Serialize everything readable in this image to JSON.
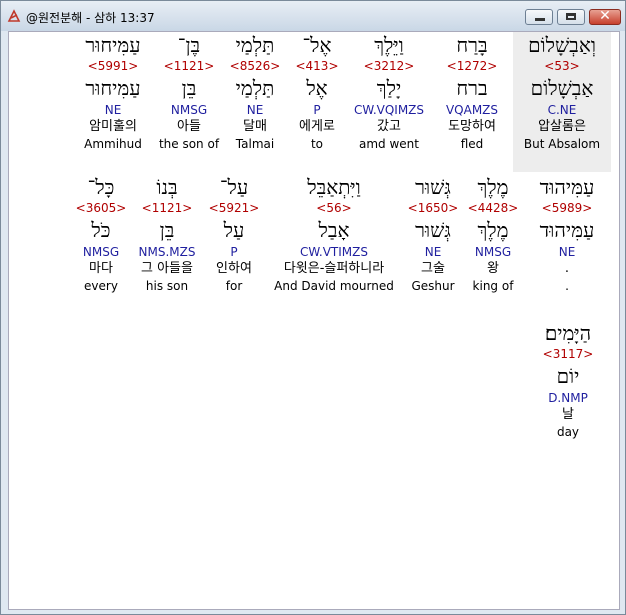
{
  "window": {
    "title": "@원전분해 - 삼하 13:37",
    "icons": {
      "app": "app-logo-icon",
      "minimize": "minimize-icon",
      "maximize": "maximize-icon",
      "close": "close-icon"
    }
  },
  "rows": [
    [
      {
        "heb": "וְאַבְשָׁלוֹם",
        "num": "<53>",
        "lemma": "אַבְשָׁלוֹם",
        "parse": "C.NE",
        "kor": "압살롬은",
        "eng": "But Absalom",
        "selected": true
      },
      {
        "heb": "בָּרַח",
        "num": "<1272>",
        "lemma": "ברח",
        "parse": "VQAMZS",
        "kor": "도망하여",
        "eng": "fled"
      },
      {
        "heb": "וַיֵּלֶךְ",
        "num": "<3212>",
        "lemma": "יָלַךְ",
        "parse": "CW.VQIMZS",
        "kor": "갔고",
        "eng": "amd went"
      },
      {
        "heb": "אֶל־",
        "num": "<413>",
        "lemma": "אֶל",
        "parse": "P",
        "kor": "에게로",
        "eng": "to"
      },
      {
        "heb": "תַּלְמַי",
        "num": "<8526>",
        "lemma": "תַּלְמַי",
        "parse": "NE",
        "kor": "달매",
        "eng": "Talmai"
      },
      {
        "heb": "בֶּן־",
        "num": "<1121>",
        "lemma": "בֵּן",
        "parse": "NMSG",
        "kor": "아들",
        "eng": "the son of"
      },
      {
        "heb": "עַמִּיחוּר",
        "num": "<5991>",
        "lemma": "עַמִּיחוּר",
        "parse": "NE",
        "kor": "암미훌의",
        "eng": "Ammihud"
      }
    ],
    [
      {
        "heb": "עַמִּיהוּד",
        "num": "<5989>",
        "lemma": "עַמִּיהוּד",
        "parse": "NE",
        "kor": ".",
        "eng": "."
      },
      {
        "heb": "מֶלֶךְ",
        "num": "<4428>",
        "lemma": "מֶלֶךְ",
        "parse": "NMSG",
        "kor": "왕",
        "eng": "king of"
      },
      {
        "heb": "גְּשׁוּר",
        "num": "<1650>",
        "lemma": "גְּשׁוּר",
        "parse": "NE",
        "kor": "그술",
        "eng": "Geshur"
      },
      {
        "heb": "וַיִּתְאַבֵּל",
        "num": "<56>",
        "lemma": "אָבַל",
        "parse": "CW.VTIMZS",
        "kor": "다윗은-슬퍼하니라",
        "eng": "And David mourned"
      },
      {
        "heb": "עַל־",
        "num": "<5921>",
        "lemma": "עַל",
        "parse": "P",
        "kor": "인하여",
        "eng": "for"
      },
      {
        "heb": "בְּנוֹ",
        "num": "<1121>",
        "lemma": "בֵּן",
        "parse": "NMS.MZS",
        "kor": "그 아들을",
        "eng": "his son"
      },
      {
        "heb": "כָּל־",
        "num": "<3605>",
        "lemma": "כֹּל",
        "parse": "NMSG",
        "kor": "마다",
        "eng": "every"
      }
    ],
    [
      {
        "heb": "הַיָּמִים׃",
        "num": "<3117>",
        "lemma": "יוֹם",
        "parse": "D.NMP",
        "kor": "날",
        "eng": "day"
      }
    ]
  ]
}
